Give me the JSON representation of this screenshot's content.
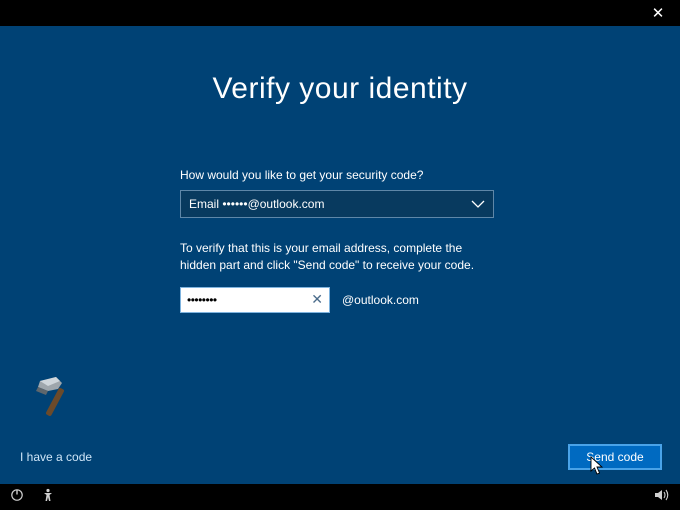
{
  "titlebar": {
    "close_glyph": "✕"
  },
  "heading": "Verify your identity",
  "prompt_method": "How would you like to get your security code?",
  "select": {
    "prefix": "Email ",
    "masked": "••••••",
    "domain": "@outlook.com"
  },
  "prompt_verify": "To verify that this is your email address, complete the hidden part and click \"Send code\" to receive your code.",
  "email_input": {
    "value": "••••••••",
    "clear_glyph": "✕",
    "domain_suffix": "@outlook.com"
  },
  "have_code_link": "I have a code",
  "send_button": "Send code",
  "colors": {
    "panel_bg": "#004275",
    "button_bg": "#006ac1",
    "button_border": "#4aa3e8"
  }
}
